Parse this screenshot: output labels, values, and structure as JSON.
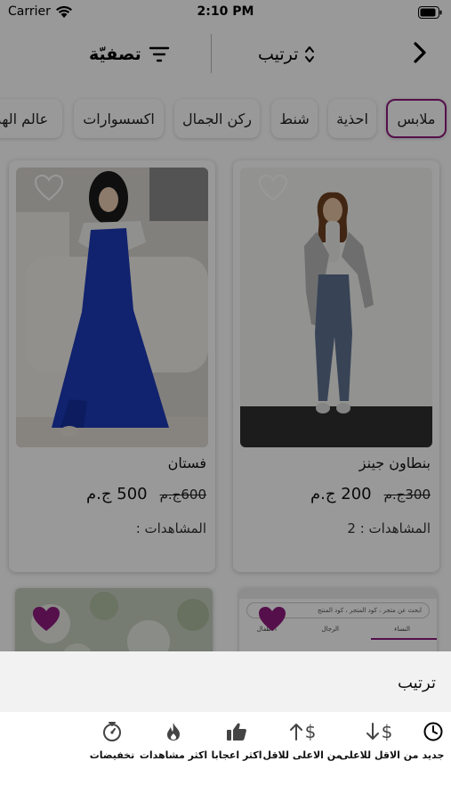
{
  "status_bar": {
    "carrier": "Carrier",
    "time": "2:10 PM"
  },
  "nav": {
    "sort_label": "ترتيب",
    "filter_label": "تصفيّة"
  },
  "categories": [
    {
      "label": "ملابس",
      "active": true
    },
    {
      "label": "احذية",
      "active": false
    },
    {
      "label": "شنط",
      "active": false
    },
    {
      "label": "ركن الجمال",
      "active": false
    },
    {
      "label": "اكسسوارات",
      "active": false
    },
    {
      "label": "عالم الهد",
      "active": false
    }
  ],
  "products": [
    {
      "name": "بنطاون جينز",
      "price_new": "200 ج.م",
      "price_old": "300ج.م",
      "views": "المشاهدات : 2",
      "favorite": false
    },
    {
      "name": "فستان",
      "price_new": "500 ج.م",
      "price_old": "600ج.م",
      "views": "المشاهدات :",
      "favorite": false
    }
  ],
  "partial_products": [
    {
      "favorite": true,
      "preview_search_text": "ابحث عن متجر ، كود المتجر ، كود المنتج",
      "preview_tabs": [
        "النساء",
        "الرجال",
        "الاطفال"
      ]
    },
    {
      "favorite": true
    }
  ],
  "sheet": {
    "title": "ترتيب",
    "options": [
      {
        "label": "جديد",
        "icon": "clock-icon"
      },
      {
        "label": "من الاقل للاعلى",
        "icon": "dollar-arrow-down-icon"
      },
      {
        "label": "من الاعلى للاقل",
        "icon": "dollar-arrow-up-icon"
      },
      {
        "label": "اكثر اعجابا",
        "icon": "thumbs-up-icon"
      },
      {
        "label": "اكثر مشاهدات",
        "icon": "flame-icon"
      },
      {
        "label": "تخفيضات",
        "icon": "discount-timer-icon"
      }
    ]
  },
  "colors": {
    "accent": "#8e1a7e",
    "heart_active": "#8e1a7e"
  }
}
